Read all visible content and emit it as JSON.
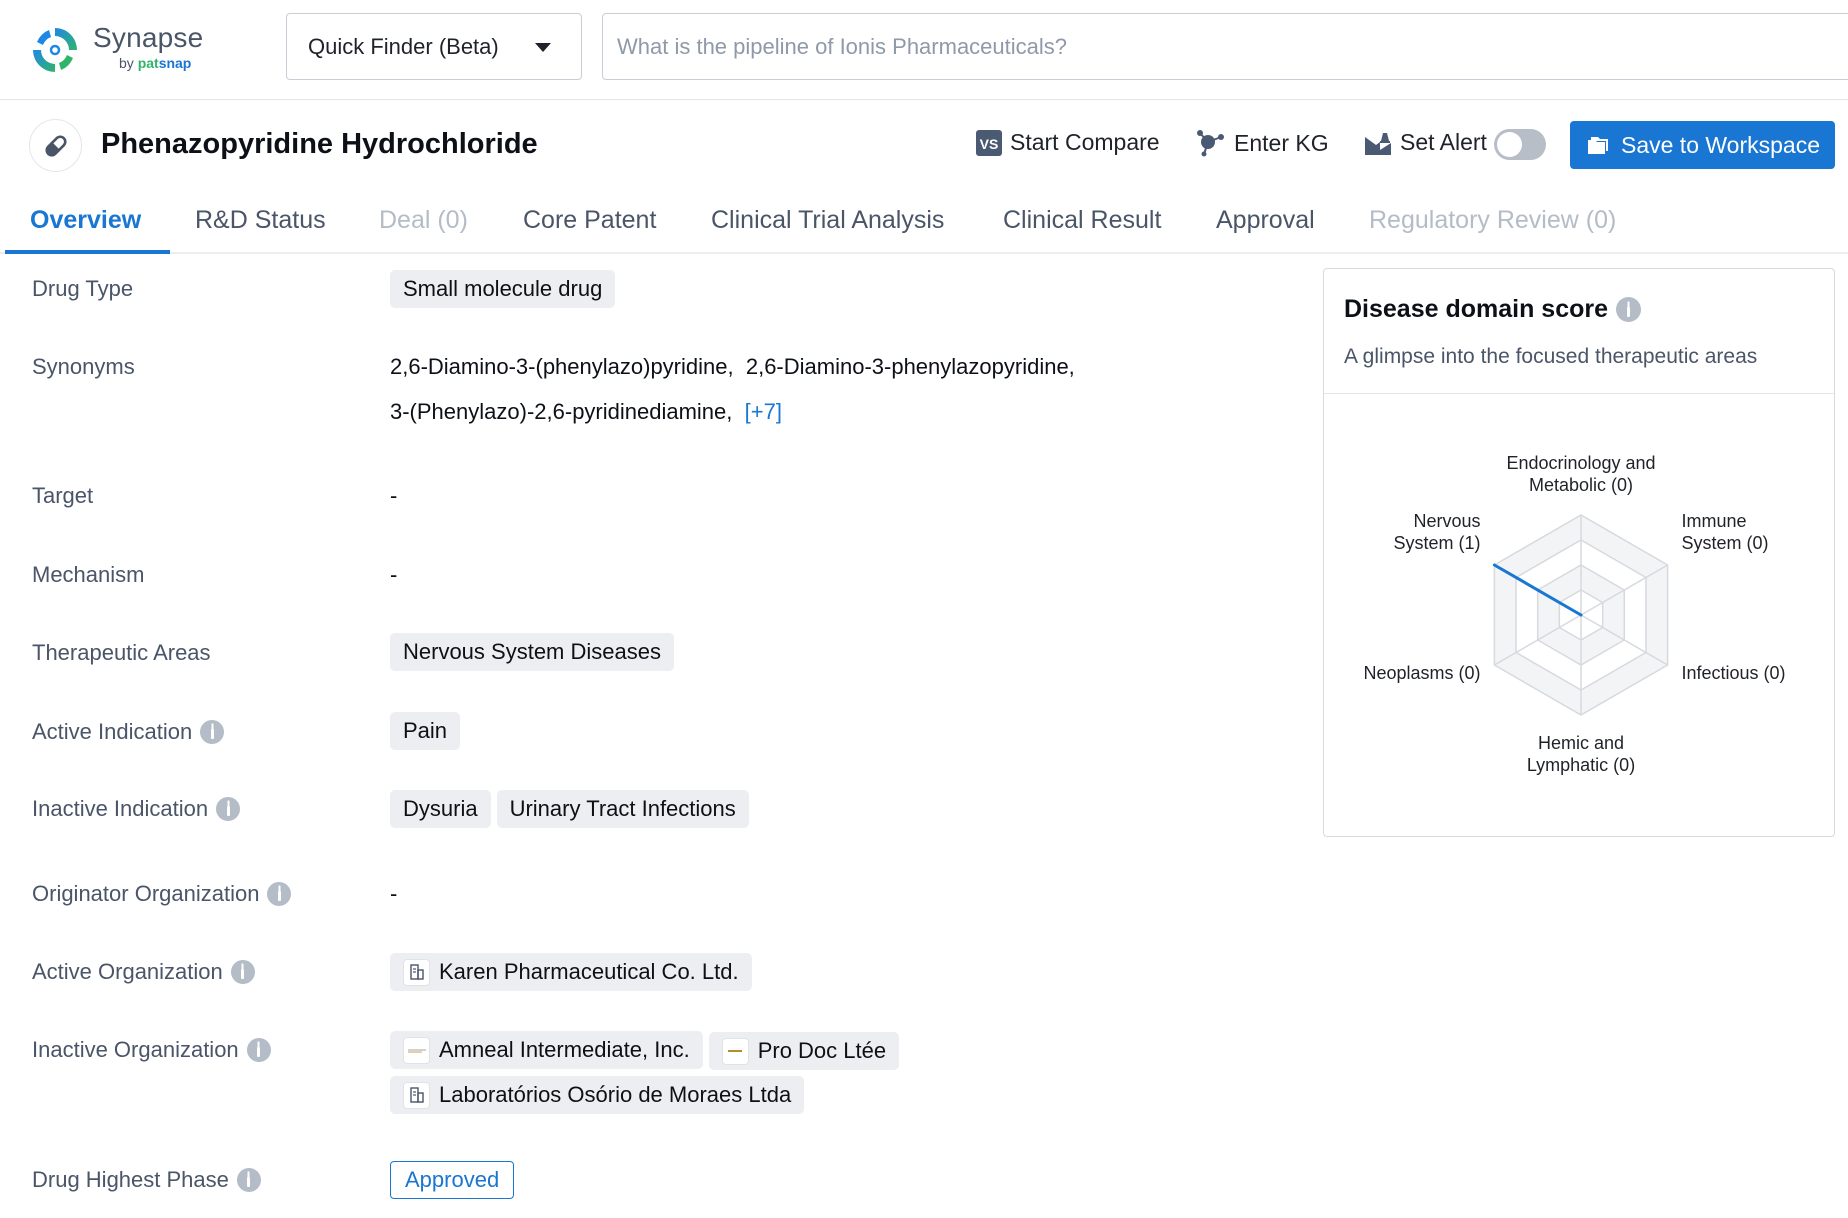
{
  "header": {
    "logo_text": "Synapse",
    "logo_sub_by": "by ",
    "logo_sub_pat": "pat",
    "logo_sub_snap": "snap",
    "quick_finder_label": "Quick Finder (Beta)",
    "search_placeholder": "What is the pipeline of Ionis Pharmaceuticals?",
    "search_value": ""
  },
  "drug": {
    "title": "Phenazopyridine Hydrochloride",
    "icon": "pill-icon"
  },
  "actions": {
    "start_compare": "Start Compare",
    "enter_kg": "Enter KG",
    "set_alert": "Set Alert",
    "set_alert_enabled": false,
    "save_to_workspace": "Save to Workspace"
  },
  "tabs": [
    {
      "label": "Overview",
      "state": "active"
    },
    {
      "label": "R&D Status",
      "state": "normal"
    },
    {
      "label": "Deal (0)",
      "state": "disabled"
    },
    {
      "label": "Core Patent",
      "state": "normal"
    },
    {
      "label": "Clinical Trial Analysis",
      "state": "normal"
    },
    {
      "label": "Clinical Result",
      "state": "normal"
    },
    {
      "label": "Approval",
      "state": "normal"
    },
    {
      "label": "Regulatory Review (0)",
      "state": "disabled"
    }
  ],
  "overview": {
    "drug_type": {
      "label": "Drug Type",
      "value": "Small molecule drug"
    },
    "synonyms": {
      "label": "Synonyms",
      "items": [
        "2,6-Diamino-3-(phenylazo)pyridine,",
        "2,6-Diamino-3-phenylazopyridine,",
        "3-(Phenylazo)-2,6-pyridinediamine,"
      ],
      "more": "[+7]"
    },
    "target": {
      "label": "Target",
      "value": "-"
    },
    "mechanism": {
      "label": "Mechanism",
      "value": "-"
    },
    "therapeutic_areas": {
      "label": "Therapeutic Areas",
      "values": [
        "Nervous System Diseases"
      ]
    },
    "active_indication": {
      "label": "Active Indication",
      "values": [
        "Pain"
      ]
    },
    "inactive_indication": {
      "label": "Inactive Indication",
      "values": [
        "Dysuria",
        "Urinary Tract Infections"
      ]
    },
    "originator_organization": {
      "label": "Originator Organization",
      "value": "-"
    },
    "active_organization": {
      "label": "Active Organization",
      "values": [
        "Karen Pharmaceutical Co. Ltd."
      ]
    },
    "inactive_organization": {
      "label": "Inactive Organization",
      "values": [
        "Amneal Intermediate, Inc.",
        "Pro Doc Ltée",
        "Laboratórios Osório de Moraes Ltda"
      ]
    },
    "drug_highest_phase": {
      "label": "Drug Highest Phase",
      "value": "Approved"
    }
  },
  "disease_domain_card": {
    "title": "Disease domain score",
    "subtitle": "A glimpse into the focused therapeutic areas"
  },
  "chart_data": {
    "type": "radar",
    "title": "Disease domain score",
    "axes": [
      {
        "name": "Endocrinology and Metabolic",
        "value": 0,
        "label_lines": [
          "Endocrinology and",
          "Metabolic (0)"
        ]
      },
      {
        "name": "Immune System",
        "value": 0,
        "label_lines": [
          "Immune",
          "System (0)"
        ]
      },
      {
        "name": "Infectious",
        "value": 0,
        "label_lines": [
          "Infectious (0)"
        ]
      },
      {
        "name": "Hemic and Lymphatic",
        "value": 0,
        "label_lines": [
          "Hemic and",
          "Lymphatic (0)"
        ]
      },
      {
        "name": "Neoplasms",
        "value": 0,
        "label_lines": [
          "Neoplasms (0)"
        ]
      },
      {
        "name": "Nervous System",
        "value": 1,
        "label_lines": [
          "Nervous",
          "System (1)"
        ]
      }
    ],
    "max": 1,
    "rings": 4,
    "series_color": "#1976d2"
  },
  "colors": {
    "accent": "#1976d2",
    "muted_text": "#4a5568",
    "chip_bg": "#eceef2"
  }
}
